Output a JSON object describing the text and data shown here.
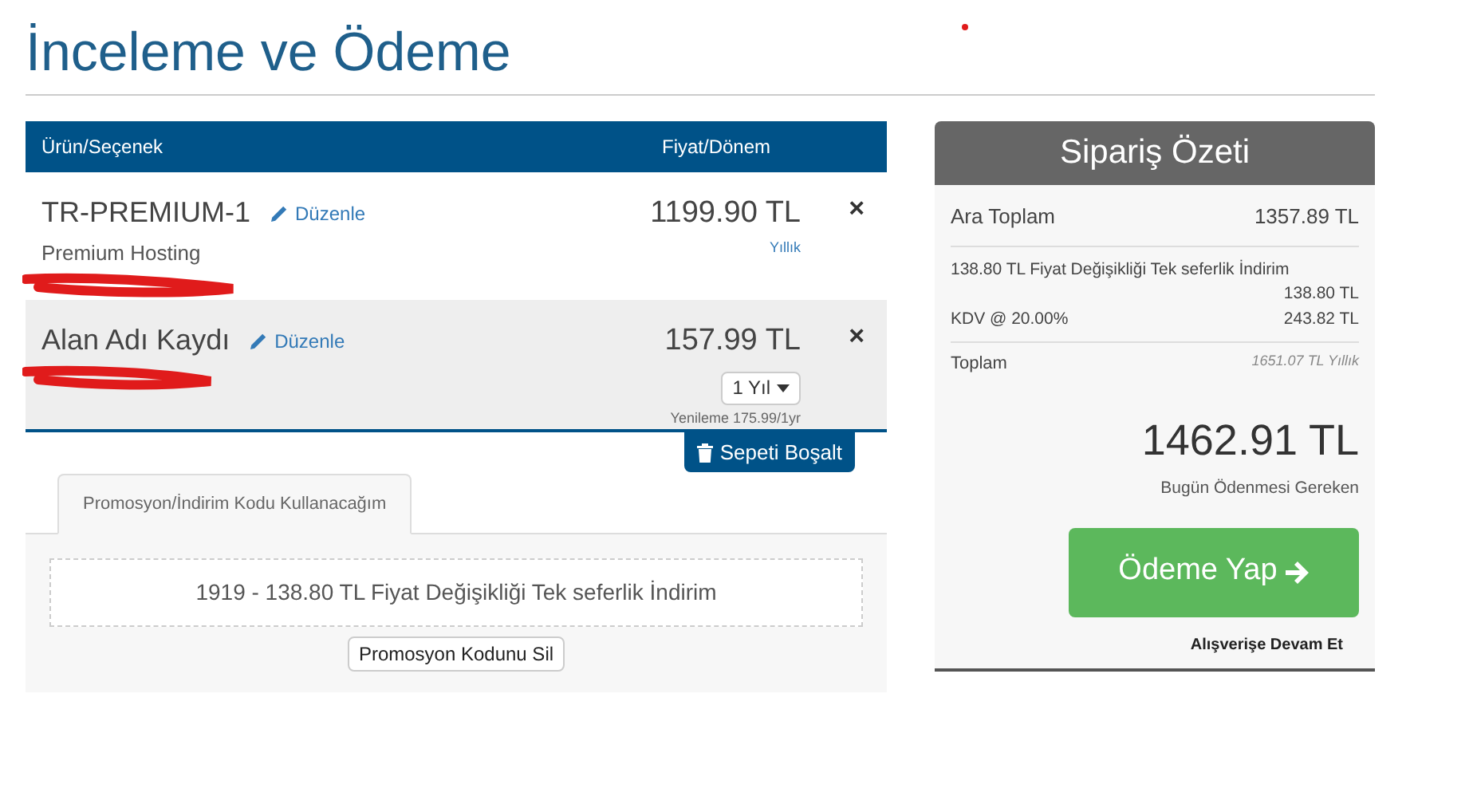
{
  "page_title": "İnceleme ve Ödeme",
  "cart": {
    "columns": [
      "Ürün/Seçenek",
      "Fiyat/Dönem"
    ],
    "items": [
      {
        "name": "TR-PREMIUM-1",
        "edit_link": "Düzenle",
        "group": "Premium Hosting",
        "price": "1199.90 TL",
        "cycle": "Yıllık",
        "remove": "×",
        "shaded": false
      },
      {
        "name": "Alan Adı Kaydı",
        "edit_link": "Düzenle",
        "price": "157.99 TL",
        "period_select": "1 Yıl",
        "renewal": "Yenileme 175.99/1yr",
        "remove": "×",
        "shaded": true
      }
    ],
    "empty_button": "Sepeti Boşalt"
  },
  "promo": {
    "tabs": [
      {
        "label": "Promosyon/İndirim Kodu Kullanacağım",
        "selected": true
      }
    ],
    "applied_code": "1919 - 138.80 TL Fiyat Değişikliği Tek seferlik İndirim",
    "remove_button": "Promosyon Kodunu Sil"
  },
  "summary": {
    "title": "Sipariş Özeti",
    "subtotal_label": "Ara Toplam",
    "subtotal": "1357.89 TL",
    "discount_label": "138.80 TL Fiyat Değişikliği Tek seferlik İndirim",
    "discount": "138.80 TL",
    "tax_label": "KDV @ 20.00%",
    "tax": "243.82 TL",
    "total_label": "Toplam",
    "recurring": "1651.07 TL Yıllık",
    "due_today": "1462.91 TL",
    "due_today_label": "Bugün Ödenmesi Gereken",
    "checkout_button": "Ödeme Yap",
    "continue_link": "Alışverişe Devam Et"
  }
}
